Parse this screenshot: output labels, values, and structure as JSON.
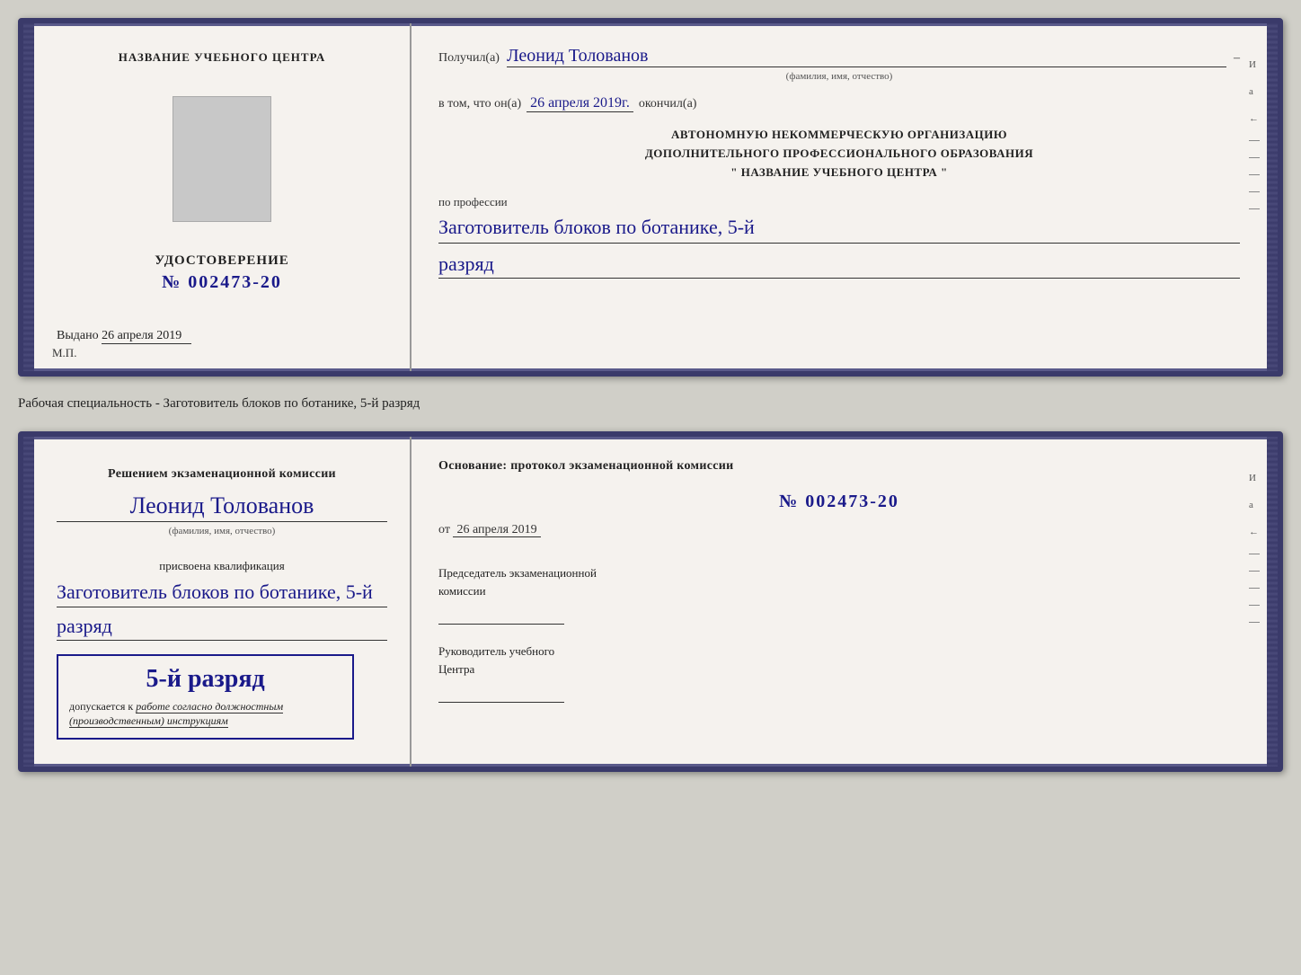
{
  "top_card": {
    "left": {
      "center_title": "НАЗВАНИЕ УЧЕБНОГО ЦЕНТРА",
      "udostoverenie_title": "УДОСТОВЕРЕНИЕ",
      "number": "№ 002473-20",
      "issued_label": "Выдано",
      "issued_date": "26 апреля 2019",
      "mp_label": "М.П."
    },
    "right": {
      "recipient_label": "Получил(а)",
      "recipient_name": "Леонид Толованов",
      "fio_subtitle": "(фамилия, имя, отчество)",
      "vtom_label": "в том, что он(а)",
      "vtom_date": "26 апреля 2019г.",
      "okончил": "окончил(а)",
      "org_line1": "АВТОНОМНУЮ НЕКОММЕРЧЕСКУЮ ОРГАНИЗАЦИЮ",
      "org_line2": "ДОПОЛНИТЕЛЬНОГО ПРОФЕССИОНАЛЬНОГО ОБРАЗОВАНИЯ",
      "org_line3": "\" НАЗВАНИЕ УЧЕБНОГО ЦЕНТРА \"",
      "profession_label": "по профессии",
      "profession_value": "Заготовитель блоков по ботанике, 5-й",
      "razryad_value": "разряд"
    }
  },
  "specialty_label": "Рабочая специальность - Заготовитель блоков по ботанике, 5-й разряд",
  "bottom_card": {
    "left": {
      "decision_text": "Решением экзаменационной комиссии",
      "person_name": "Леонид Толованов",
      "fio_subtitle": "(фамилия, имя, отчество)",
      "prisvoena_text": "присвоена квалификация",
      "qualification_value": "Заготовитель блоков по ботанике, 5-й",
      "razryad_value": "разряд",
      "stamp_rank": "5-й разряд",
      "stamp_admission_prefix": "допускается к",
      "stamp_admission_text": "работе согласно должностным",
      "stamp_admission_text2": "(производственным) инструкциям"
    },
    "right": {
      "osnov_text": "Основание: протокол экзаменационной комиссии",
      "protocol_number": "№ 002473-20",
      "from_prefix": "от",
      "from_date": "26 апреля 2019",
      "chairman_title": "Председатель экзаменационной",
      "chairman_title2": "комиссии",
      "head_title": "Руководитель учебного",
      "head_title2": "Центра"
    }
  },
  "right_side_markers": {
    "items": [
      "И",
      "а",
      "←",
      "–",
      "–",
      "–",
      "–",
      "–"
    ]
  }
}
